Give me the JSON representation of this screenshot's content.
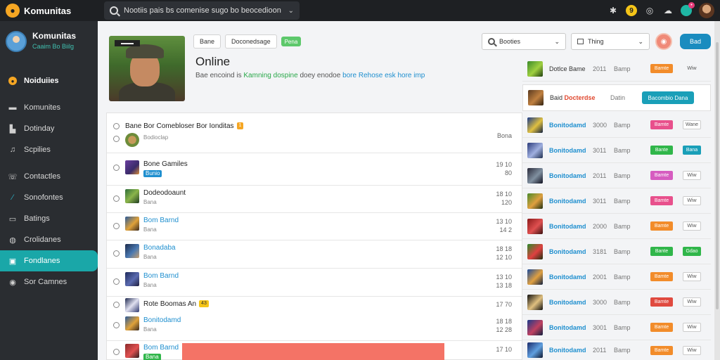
{
  "app": {
    "name": "Komunitas",
    "search_text": "Nootiis pais bs comenise sugo bo beocedioon"
  },
  "sidebar": {
    "profile_name": "Komunitas",
    "profile_sub": "Caaim Bo Biilg",
    "items": [
      {
        "label": "Noiduiies",
        "icon": "notification-icon"
      },
      {
        "label": "Komunites",
        "icon": "community-icon"
      },
      {
        "label": "Dotinday",
        "icon": "daily-icon"
      },
      {
        "label": "Scpilies",
        "icon": "supplies-icon"
      },
      {
        "label": "Contactles",
        "icon": "contacts-icon"
      },
      {
        "label": "Sonofontes",
        "icon": "feather-icon"
      },
      {
        "label": "Batings",
        "icon": "settings-icon"
      },
      {
        "label": "Crolidanes",
        "icon": "credits-icon"
      },
      {
        "label": "Fondlanes",
        "icon": "friends-icon"
      },
      {
        "label": "Sor Camnes",
        "icon": "games-icon"
      }
    ]
  },
  "header": {
    "chips": [
      "Bane",
      "Doconedsage",
      "Pena"
    ],
    "title": "Online",
    "desc_plain": "Bae encoind is ",
    "desc_green": "Kamning dospine",
    "desc_mid": " doey enodoe ",
    "desc_blue": "bore Rehose esk hore imp"
  },
  "filters": {
    "filter1": "Booties",
    "filter2": "Thing",
    "add_label": "Bad"
  },
  "list": [
    {
      "title": "Bane  Bor Comebloser Bor Ionditas",
      "tag": "1",
      "sub": "Bodioclap",
      "right": [
        "Bona"
      ]
    },
    {
      "title": "Bone Gamiles",
      "sub": "Bunio",
      "right": [
        "19 10",
        "80"
      ]
    },
    {
      "title": "Dodeodoaunt",
      "sub": "Bana",
      "right": [
        "18 10",
        "120"
      ]
    },
    {
      "title": "Bom Barnd",
      "sub": "Bana",
      "right": [
        "13 10",
        "14 2"
      ]
    },
    {
      "title": "Bonadaba",
      "sub": "Bana",
      "right": [
        "18 18",
        "12 10"
      ]
    },
    {
      "title": "Bom Barnd",
      "sub": "Bana",
      "right": [
        "13 10",
        "13 18"
      ]
    },
    {
      "title": "Rote Boomas  An",
      "tag": "43",
      "sub": "",
      "right": [
        "17 70"
      ]
    },
    {
      "title": "Bonitodamd",
      "sub": "Bana",
      "right": [
        "18 18",
        "12 28"
      ]
    },
    {
      "title": "Bom Barnd",
      "sub": "Bana",
      "right": [
        "17 10"
      ]
    }
  ],
  "right_list": [
    {
      "name": "Dotlce Bame",
      "num": "2011",
      "lbl": "Bamp",
      "pill": "Bamte",
      "pill_color": "#f28c2a",
      "extra": "Wiw"
    },
    {
      "name": "Baid",
      "name_red": "Docterdse",
      "num": "",
      "lbl": "Datin",
      "wide": "Bacombio Dana"
    },
    {
      "name": "Bonitodamd",
      "num": "3000",
      "lbl": "Bamp",
      "pill": "Bamte",
      "pill_color": "#e8508c",
      "extra": "Wane"
    },
    {
      "name": "Bonitodamd",
      "num": "3011",
      "lbl": "Bamp",
      "pill": "Bante",
      "pill_color": "#30b64a",
      "extra": "Bana",
      "extra_style": "teal"
    },
    {
      "name": "Bonitodamd",
      "num": "2011",
      "lbl": "Bamp",
      "pill": "Bamte",
      "pill_color": "#d65cc0",
      "extra": "Wiw"
    },
    {
      "name": "Bonitodamd",
      "num": "3011",
      "lbl": "Bamp",
      "pill": "Bamte",
      "pill_color": "#e8508c",
      "extra": "Wiw"
    },
    {
      "name": "Bonitodamd",
      "num": "2000",
      "lbl": "Bamp",
      "pill": "Bamte",
      "pill_color": "#f28c2a",
      "extra": "Wiw"
    },
    {
      "name": "Bonitodamd",
      "num": "3181",
      "lbl": "Bamp",
      "pill": "Bante",
      "pill_color": "#30b64a",
      "extra": "Gdao",
      "extra_style": "green"
    },
    {
      "name": "Bonitodamd",
      "num": "2001",
      "lbl": "Bamp",
      "pill": "Bamte",
      "pill_color": "#f28c2a",
      "extra": "Wiw"
    },
    {
      "name": "Bonitodamd",
      "num": "3000",
      "lbl": "Bamp",
      "pill": "Bamte",
      "pill_color": "#e04a3f",
      "extra": "Wiw"
    },
    {
      "name": "Bonitodamd",
      "num": "3001",
      "lbl": "Bamp",
      "pill": "Bamte",
      "pill_color": "#f28c2a",
      "extra": "Wiw"
    },
    {
      "name": "Bonitodamd",
      "num": "2011",
      "lbl": "Bamp",
      "pill": "Bamte",
      "pill_color": "#f28c2a",
      "extra": "Wiw"
    }
  ],
  "colors": {
    "accent": "#1aa7a8",
    "brand": "#f5a623",
    "link": "#1f8fcf"
  }
}
